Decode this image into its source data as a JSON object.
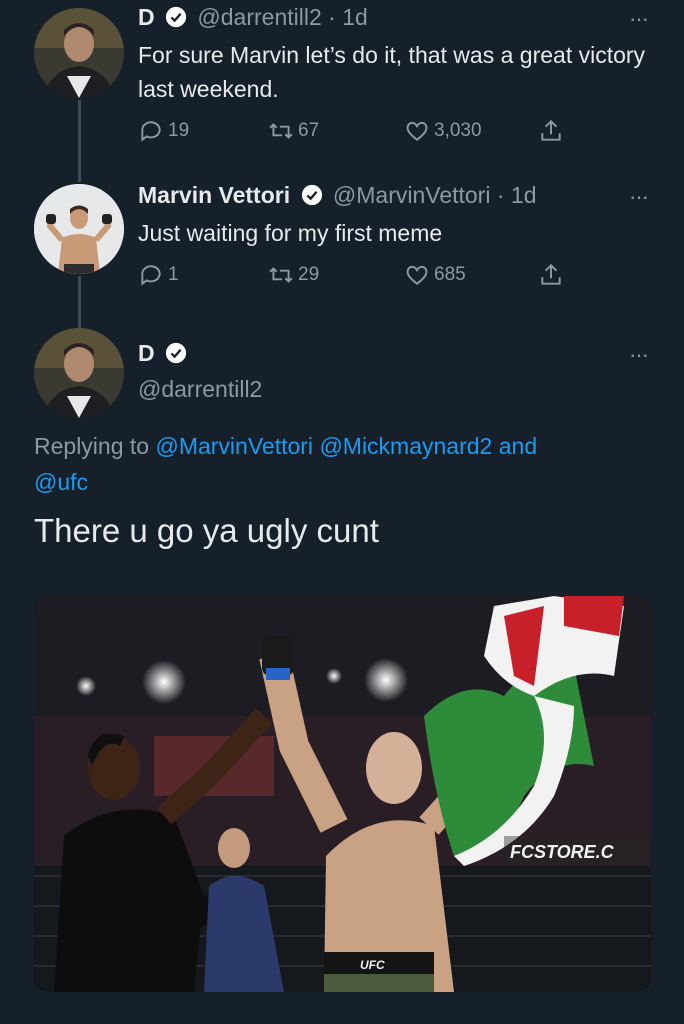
{
  "tweet1": {
    "name": "D",
    "handle": "@darrentill2",
    "separator": "·",
    "time": "1d",
    "more": "···",
    "text": "For sure Marvin let’s do it, that was a great victory last weekend.",
    "replies": "19",
    "retweets": "67",
    "likes": "3,030"
  },
  "tweet2": {
    "name": "Marvin Vettori",
    "handle": "@MarvinVettori",
    "separator": "·",
    "time": "1d",
    "more": "···",
    "text": "Just waiting for my first meme",
    "replies": "1",
    "retweets": "29",
    "likes": "685"
  },
  "tweet3": {
    "name": "D",
    "handle": "@darrentill2",
    "more": "···",
    "replying_prefix": "Replying to",
    "mention1": "@MarvinVettori",
    "mention2": "@Mickmaynard2",
    "and_word": "and",
    "mention3": "@ufc",
    "text": "There u go ya ugly cunt",
    "photo_banner": "FCSTORE.C",
    "photo_shorts": "UFC"
  },
  "colors": {
    "background": "#15202b",
    "link": "#1d9bf0",
    "muted": "#8b98a5",
    "verified": "#ffffff"
  },
  "icons": [
    "verified-badge-icon",
    "reply-icon",
    "retweet-icon",
    "like-icon",
    "share-icon",
    "more-icon"
  ]
}
